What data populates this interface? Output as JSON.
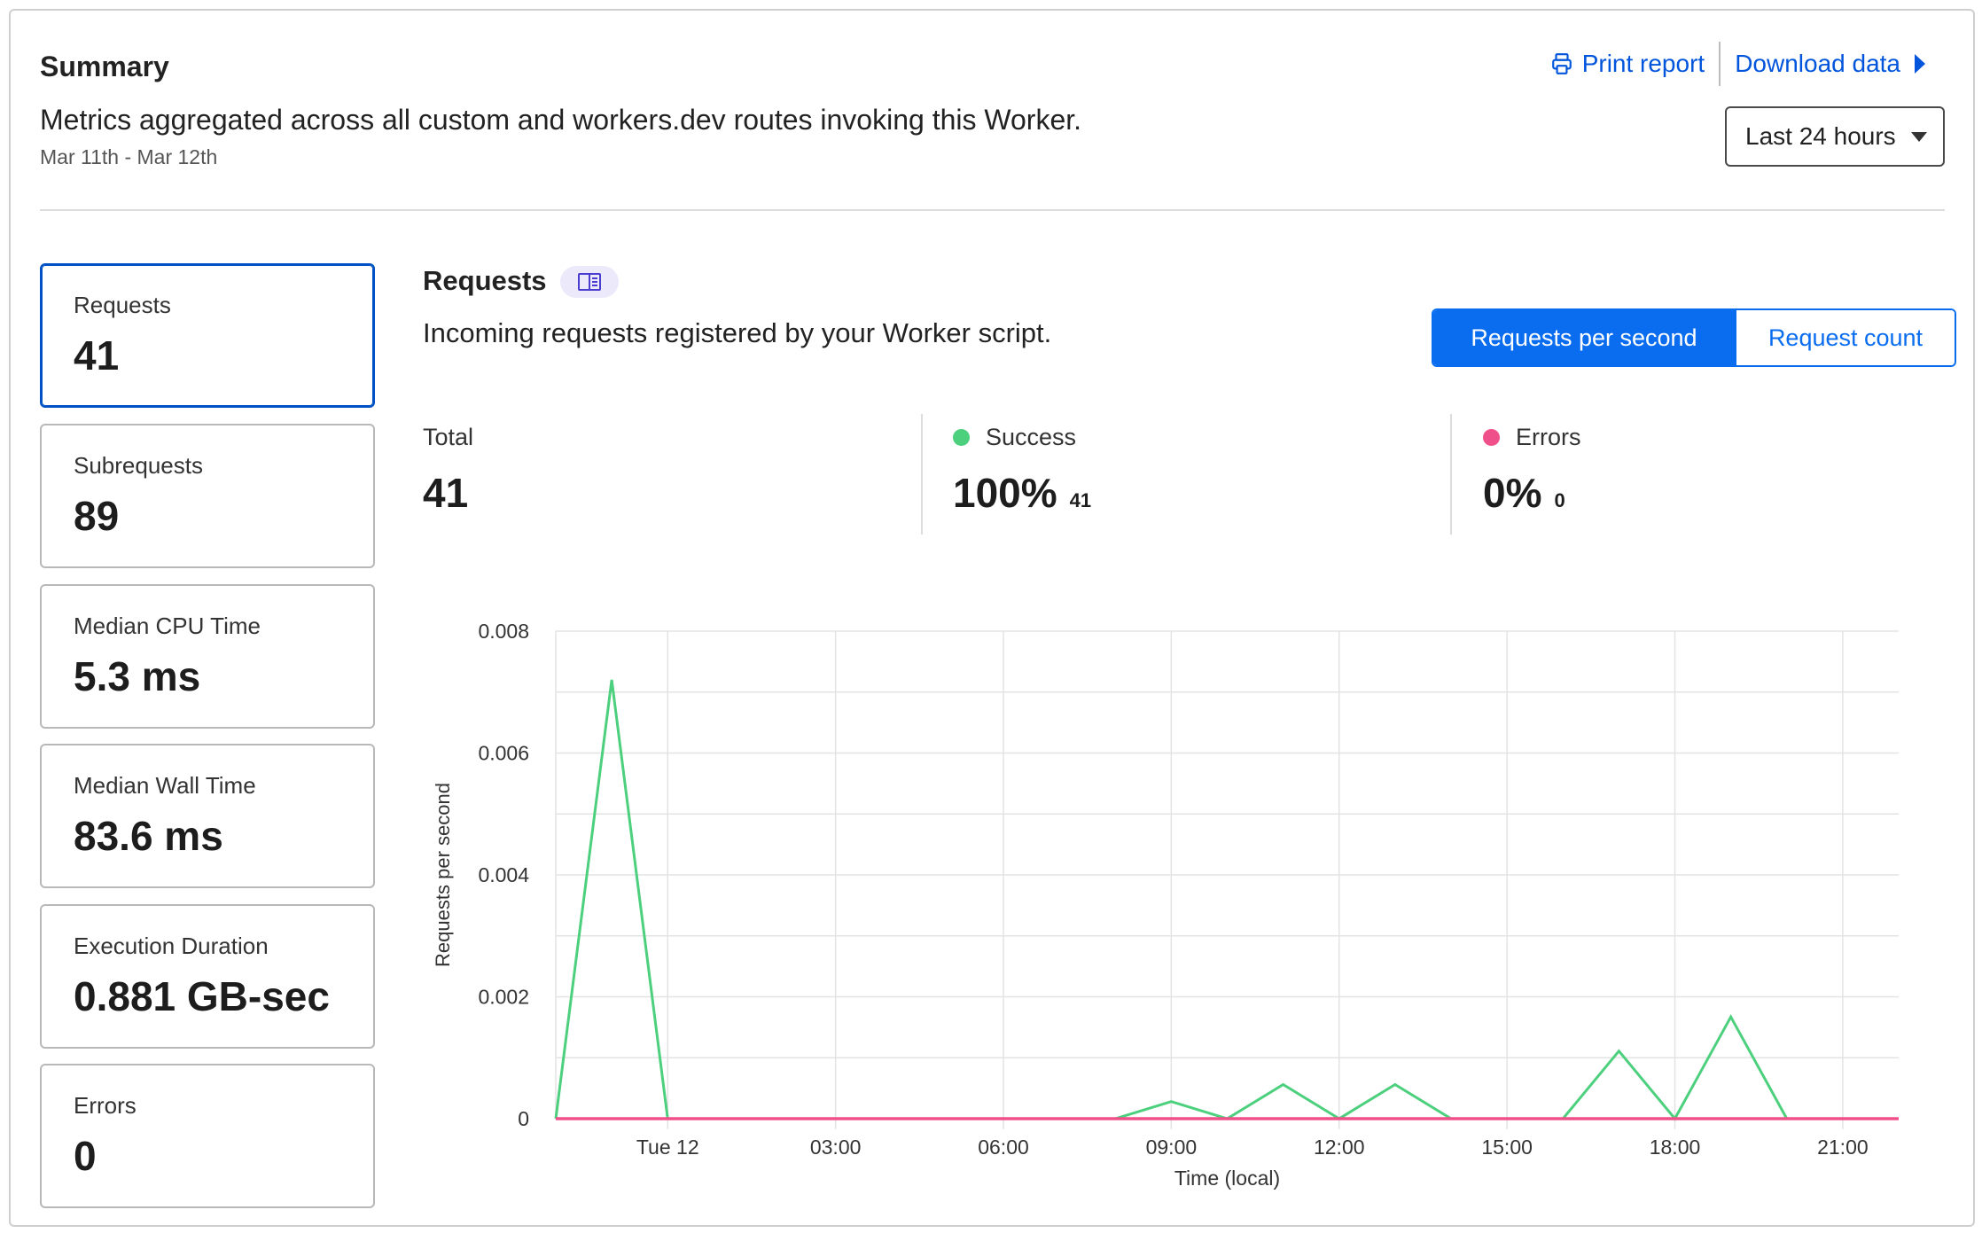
{
  "summary": {
    "title": "Summary",
    "description": "Metrics aggregated across all custom and workers.dev routes invoking this Worker.",
    "date_range": "Mar 11th - Mar 12th"
  },
  "actions": {
    "print_label": "Print report",
    "download_label": "Download data"
  },
  "time_range": {
    "selected": "Last 24 hours"
  },
  "metrics": [
    {
      "label": "Requests",
      "value": "41",
      "active": true
    },
    {
      "label": "Subrequests",
      "value": "89"
    },
    {
      "label": "Median CPU Time",
      "value": "5.3 ms"
    },
    {
      "label": "Median Wall Time",
      "value": "83.6 ms"
    },
    {
      "label": "Execution Duration",
      "value": "0.881 GB-sec"
    },
    {
      "label": "Errors",
      "value": "0"
    }
  ],
  "requests_panel": {
    "title": "Requests",
    "description": "Incoming requests registered by your Worker script.",
    "toggle": {
      "options": [
        "Requests per second",
        "Request count"
      ],
      "selected": "Requests per second"
    },
    "stats": {
      "total": {
        "label": "Total",
        "value": "41"
      },
      "success": {
        "label": "Success",
        "value": "100%",
        "count": "41",
        "color": "#4cd07d"
      },
      "errors": {
        "label": "Errors",
        "value": "0%",
        "count": "0",
        "color": "#f0508a"
      }
    }
  },
  "chart_data": {
    "type": "line",
    "xlabel": "Time (local)",
    "ylabel": "Requests per second",
    "ylim": [
      0,
      0.008
    ],
    "yticks": [
      "0",
      "0.002",
      "0.004",
      "0.006",
      "0.008"
    ],
    "x_unit": "hours since Mar 11th 23:00",
    "xlim": [
      0,
      24
    ],
    "xticks": [
      {
        "x": 2,
        "label": "Tue 12"
      },
      {
        "x": 5,
        "label": "03:00"
      },
      {
        "x": 8,
        "label": "06:00"
      },
      {
        "x": 11,
        "label": "09:00"
      },
      {
        "x": 14,
        "label": "12:00"
      },
      {
        "x": 17,
        "label": "15:00"
      },
      {
        "x": 20,
        "label": "18:00"
      },
      {
        "x": 23,
        "label": "21:00"
      }
    ],
    "grid": true,
    "series": [
      {
        "name": "Success",
        "color": "#4cd07d",
        "x": [
          0,
          1,
          2,
          3,
          4,
          5,
          6,
          7,
          8,
          9,
          10,
          11,
          12,
          13,
          14,
          15,
          16,
          17,
          18,
          19,
          20,
          21,
          22,
          23,
          24
        ],
        "values": [
          0,
          0.0072,
          0,
          0,
          0,
          0,
          0,
          0,
          0,
          0,
          0,
          0.00028,
          0,
          0.00056,
          0,
          0.00056,
          0,
          0,
          0,
          0.00111,
          0,
          0.00167,
          0,
          0,
          0
        ]
      },
      {
        "name": "Errors",
        "color": "#f0508a",
        "x": [
          0,
          24
        ],
        "values": [
          0,
          0
        ]
      }
    ]
  }
}
